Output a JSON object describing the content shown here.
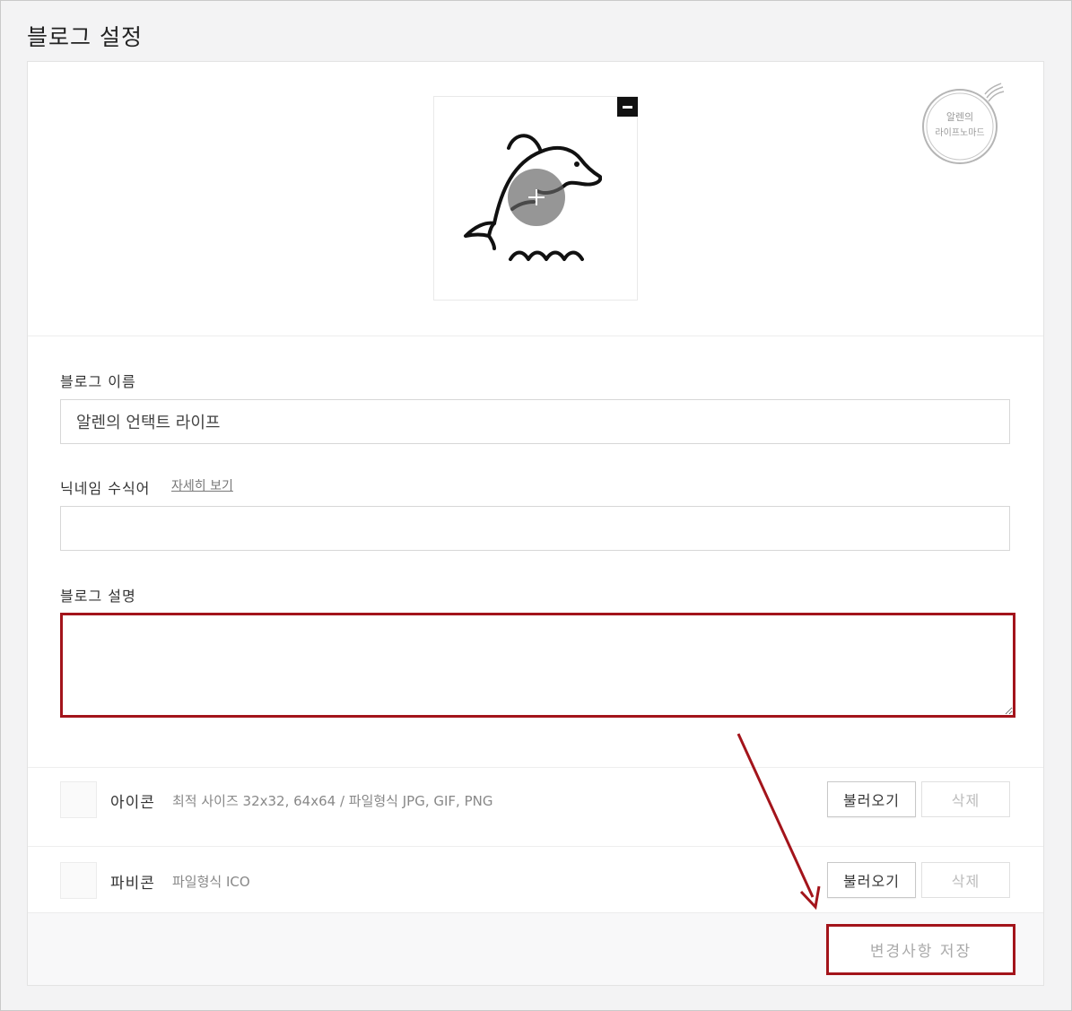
{
  "page": {
    "title": "블로그 설정"
  },
  "watermark": {
    "line1": "알렌의",
    "line2": "라이프노마드"
  },
  "blog_name": {
    "label": "블로그 이름",
    "value": "알렌의 언택트 라이프"
  },
  "nickname": {
    "label": "닉네임 수식어",
    "detail_link": "자세히 보기",
    "value": ""
  },
  "description": {
    "label": "블로그 설명",
    "value": ""
  },
  "icon_row": {
    "label": "아이콘",
    "hint": "최적 사이즈 32x32, 64x64 / 파일형식 JPG, GIF, PNG",
    "load_label": "불러오기",
    "delete_label": "삭제"
  },
  "favicon_row": {
    "label": "파비콘",
    "hint": "파일형식 ICO",
    "load_label": "불러오기",
    "delete_label": "삭제"
  },
  "footer": {
    "save_label": "변경사항 저장"
  },
  "colors": {
    "highlight": "#a3141b",
    "background": "#f3f3f4"
  },
  "icons": {
    "remove": "minus-icon",
    "add": "plus-icon",
    "logo": "dolphin-icon"
  }
}
